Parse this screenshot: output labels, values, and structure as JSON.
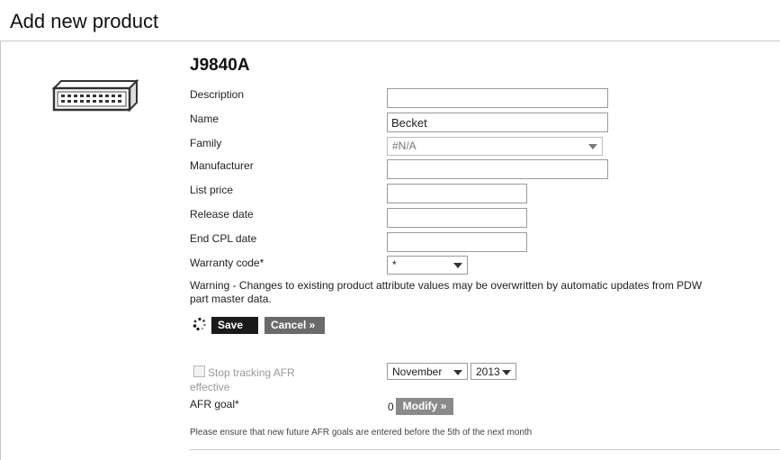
{
  "page": {
    "title": "Add new product"
  },
  "product": {
    "id": "J9840A",
    "icon": "network-switch-icon"
  },
  "form": {
    "description": {
      "label": "Description",
      "value": ""
    },
    "name": {
      "label": "Name",
      "value": "Becket"
    },
    "family": {
      "label": "Family",
      "value": "#N/A"
    },
    "manufacturer": {
      "label": "Manufacturer",
      "value": ""
    },
    "list_price": {
      "label": "List price",
      "value": ""
    },
    "release_date": {
      "label": "Release date",
      "value": ""
    },
    "end_cpl_date": {
      "label": "End CPL date",
      "value": ""
    },
    "warranty_code": {
      "label": "Warranty code*",
      "value": "*"
    }
  },
  "warning_text": "Warning - Changes to existing product attribute values may be overwritten by automatic updates from PDW part master data.",
  "buttons": {
    "save": "Save »",
    "cancel": "Cancel »",
    "modify": "Modify »"
  },
  "afr": {
    "stop_tracking_label": "Stop tracking AFR",
    "effective_label": "effective",
    "month": "November",
    "year": "2013",
    "goal_label": "AFR goal*",
    "goal_value": "0"
  },
  "note": "Please ensure that new future AFR goals are entered before the 5th of the next month",
  "colors": {
    "save_button": "#1a1a1a",
    "cancel_button": "#6a6a6a",
    "modify_button": "#8a8a8a"
  }
}
